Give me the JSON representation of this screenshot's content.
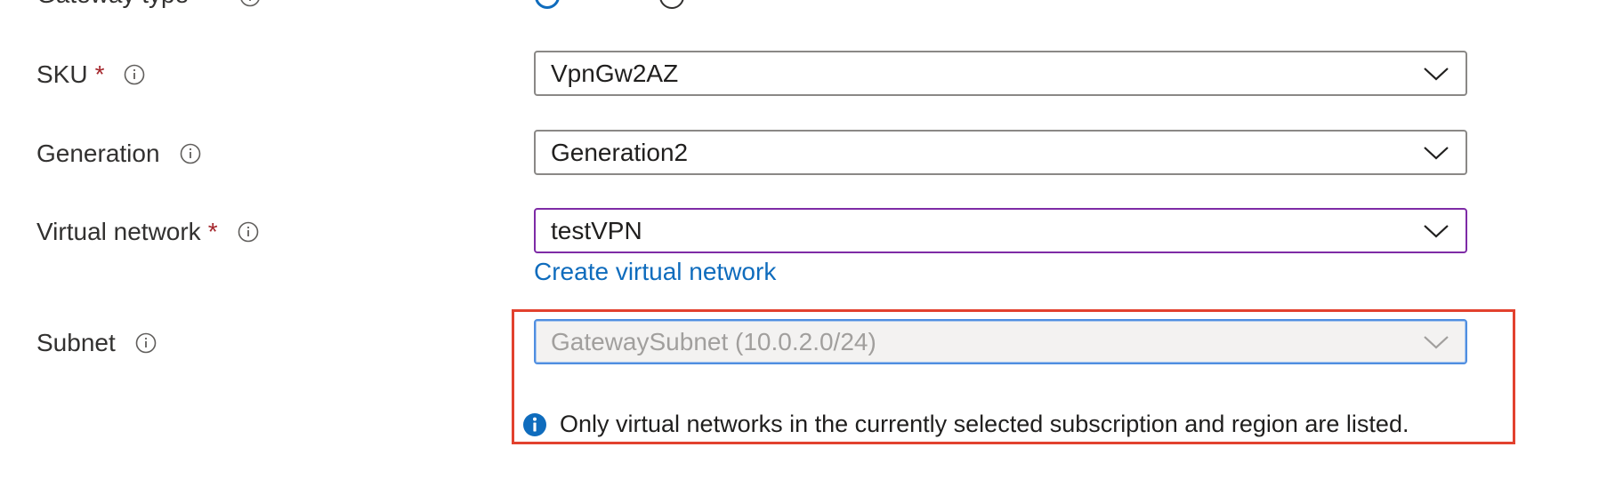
{
  "top_partial": {
    "label": "Gateway type",
    "required_mark": "*"
  },
  "form": {
    "sku": {
      "label": "SKU",
      "required_mark": "*",
      "value": "VpnGw2AZ"
    },
    "generation": {
      "label": "Generation",
      "value": "Generation2"
    },
    "virtual_network": {
      "label": "Virtual network",
      "required_mark": "*",
      "value": "testVPN",
      "create_link": "Create virtual network"
    },
    "subnet": {
      "label": "Subnet",
      "value": "GatewaySubnet (10.0.2.0/24)",
      "disabled": true
    }
  },
  "info_message": "Only virtual networks in the currently selected subscription and region are listed.",
  "colors": {
    "required": "#a4262c",
    "focus_border": "#7e2ba6",
    "link": "#0f6cbd",
    "highlight": "#e2412e",
    "info_icon": "#0f6cbd"
  },
  "icons": {
    "info": "info-icon",
    "chevron": "chevron-down-icon",
    "message_info": "info-filled-icon"
  }
}
